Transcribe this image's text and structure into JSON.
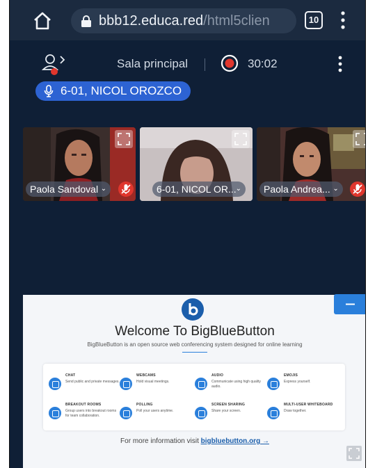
{
  "browser": {
    "url_host": "bbb12.educa.red",
    "url_path": "/html5clien",
    "tab_count": "10"
  },
  "header": {
    "room_title": "Sala principal",
    "record_time": "30:02"
  },
  "talking_indicator": "6-01, NICOL OROZCO",
  "videos": [
    {
      "name": "Paola Sandoval"
    },
    {
      "name": "6-01, NICOL OR..."
    },
    {
      "name": "Paola Andrea..."
    }
  ],
  "presentation": {
    "welcome": "Welcome To BigBlueButton",
    "subtitle": "BigBlueButton is an open source web conferencing system designed for online learning",
    "features": [
      {
        "title": "CHAT",
        "desc": "Send public and private messages."
      },
      {
        "title": "WEBCAMS",
        "desc": "Hold visual meetings."
      },
      {
        "title": "AUDIO",
        "desc": "Communicate using high quality audio."
      },
      {
        "title": "EMOJIS",
        "desc": "Express yourself."
      },
      {
        "title": "BREAKOUT ROOMS",
        "desc": "Group users into breakout rooms for team collaboration."
      },
      {
        "title": "POLLING",
        "desc": "Poll your users anytime."
      },
      {
        "title": "SCREEN SHARING",
        "desc": "Share your screen."
      },
      {
        "title": "MULTI-USER WHITEBOARD",
        "desc": "Draw together."
      }
    ],
    "more_info_prefix": "For more information visit",
    "more_info_link": "bigbluebutton.org →"
  },
  "colors": {
    "background": "#0f1f36",
    "accent": "#2a7fdb",
    "talker": "#2d63d3",
    "mute": "#e0362d"
  }
}
